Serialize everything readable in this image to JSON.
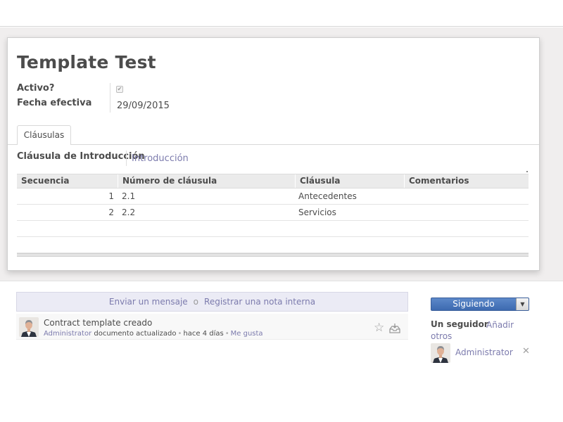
{
  "record": {
    "title": "Template Test",
    "fields": [
      {
        "label": "Activo?",
        "checked": true
      },
      {
        "label": "Fecha efectiva",
        "value": "29/09/2015"
      }
    ]
  },
  "tabs": [
    {
      "label": "Cláusulas",
      "active": true
    }
  ],
  "intro": {
    "label": "Cláusula de Introducción",
    "value": "Introducción"
  },
  "grid": {
    "columns": [
      "Secuencia",
      "Número de cláusula",
      "Cláusula",
      "Comentarios"
    ],
    "rows": [
      {
        "sequence": "1",
        "number": "2.1",
        "clause": "Antecedentes",
        "comments": ""
      },
      {
        "sequence": "2",
        "number": "2.2",
        "clause": "Servicios",
        "comments": ""
      }
    ]
  },
  "chatter": {
    "send_message": "Enviar un mensaje",
    "or": "o",
    "log_note": "Registrar una nota interna",
    "message": {
      "title": "Contract template creado",
      "author": "Administrator",
      "action": "documento actualizado",
      "time": "hace 4 días",
      "like": "Me gusta"
    }
  },
  "followers": {
    "button_label": "Siguiendo",
    "count_label": "Un seguidor",
    "add_label": "Añadir otros",
    "list": [
      {
        "name": "Administrator"
      }
    ]
  },
  "colors": {
    "link": "#7c7bad",
    "primary": "#4a77bd",
    "text": "#4c4c4c",
    "background_band": "#f0eeee"
  },
  "icons": [
    "checkbox-icon",
    "star-icon",
    "inbox-icon",
    "chevron-down-icon",
    "close-icon",
    "avatar"
  ]
}
